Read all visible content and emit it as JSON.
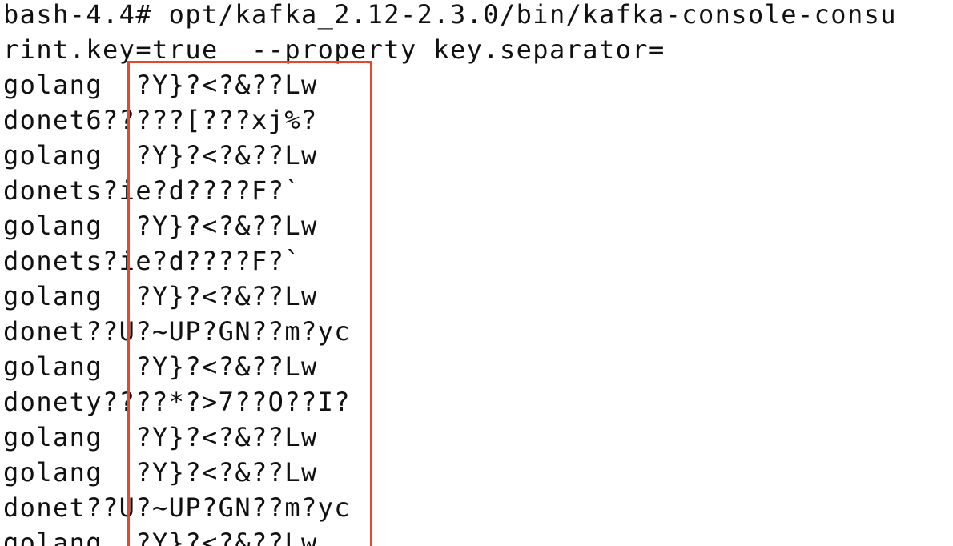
{
  "terminal": {
    "lines": [
      "bash-4.4# opt/kafka_2.12-2.3.0/bin/kafka-console-consu",
      "rint.key=true  --property key.separator=",
      "golang  ?Y}?<?&??Lw",
      "donet6?????[???xj%?",
      "golang  ?Y}?<?&??Lw",
      "donets?ie?d????F?`",
      "golang  ?Y}?<?&??Lw",
      "donets?ie?d????F?`",
      "golang  ?Y}?<?&??Lw",
      "donet??U?~UP?GN??m?yc",
      "golang  ?Y}?<?&??Lw",
      "donety????*?>7??O??I?",
      "golang  ?Y}?<?&??Lw",
      "golang  ?Y}?<?&??Lw",
      "donet??U?~UP?GN??m?yc",
      "golang  ?Y}?<?&??Lw"
    ]
  },
  "annotation": {
    "highlight_color": "#e8472f"
  }
}
